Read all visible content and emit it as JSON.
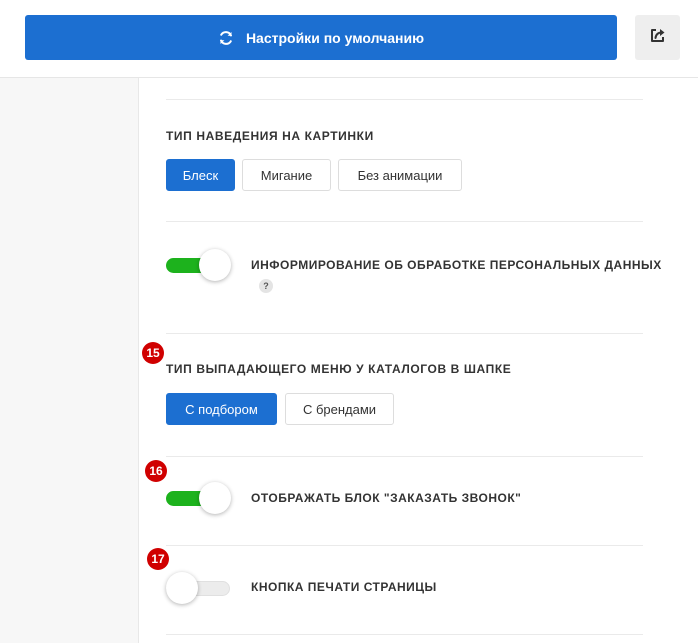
{
  "header": {
    "reset_label": "Настройки по умолчанию",
    "reset_icon": "refresh-icon",
    "share_icon": "share-icon",
    "accent_color": "#1c6fd1"
  },
  "sections": {
    "hover_type": {
      "title": "ТИП НАВЕДЕНИЯ НА КАРТИНКИ",
      "options": [
        "Блеск",
        "Мигание",
        "Без анимации"
      ],
      "selected": "Блеск"
    },
    "personal_data": {
      "label": "ИНФОРМИРОВАНИЕ ОБ ОБРАБОТКЕ ПЕРСОНАЛЬНЫХ ДАННЫХ",
      "enabled": true,
      "help": "?"
    },
    "catalog_menu": {
      "badge": "15",
      "title": "ТИП ВЫПАДАЮЩЕГО МЕНЮ У КАТАЛОГОВ В ШАПКЕ",
      "options": [
        "С подбором",
        "С брендами"
      ],
      "selected": "С подбором"
    },
    "callback_block": {
      "badge": "16",
      "label": "ОТОБРАЖАТЬ БЛОК \"ЗАКАЗАТЬ ЗВОНОК\"",
      "enabled": true
    },
    "print_button": {
      "badge": "17",
      "label": "КНОПКА ПЕЧАТИ СТРАНИЦЫ",
      "enabled": false
    }
  },
  "colors": {
    "toggle_on": "#1db21d",
    "badge": "#d00000"
  }
}
